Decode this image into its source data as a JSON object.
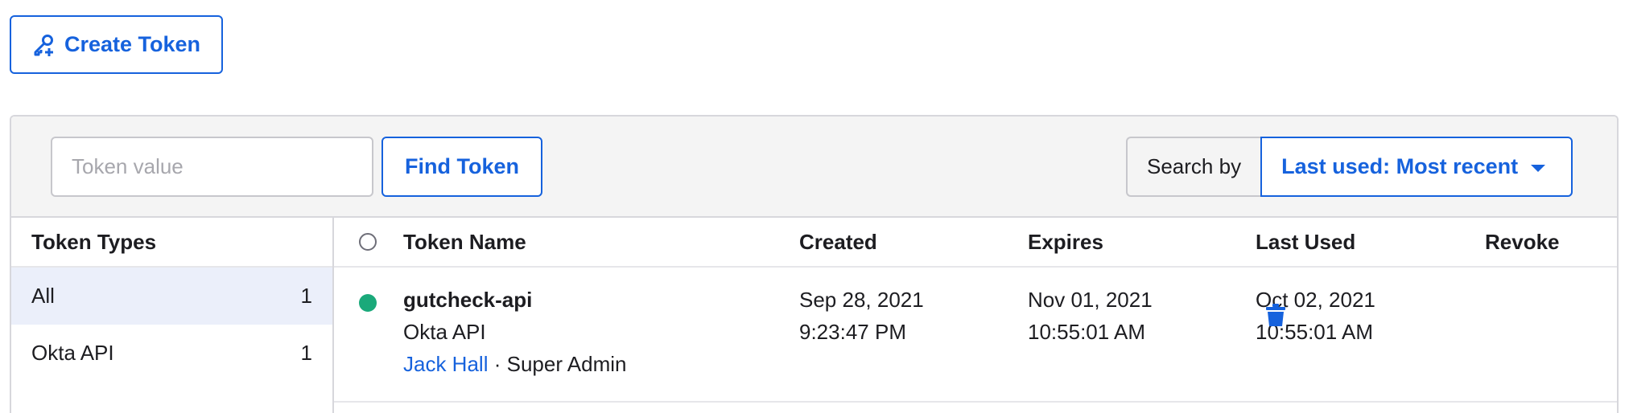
{
  "toolbar": {
    "create_token_label": "Create Token",
    "token_input_placeholder": "Token value",
    "find_token_label": "Find Token",
    "search_by_label": "Search by",
    "search_by_value": "Last used: Most recent"
  },
  "sidebar": {
    "heading": "Token Types",
    "items": [
      {
        "label": "All",
        "count": "1"
      },
      {
        "label": "Okta API",
        "count": "1"
      }
    ]
  },
  "table": {
    "columns": {
      "name": "Token Name",
      "created": "Created",
      "expires": "Expires",
      "last_used": "Last Used",
      "revoke": "Revoke"
    },
    "rows": [
      {
        "status_color": "#1aa97a",
        "name": "gutcheck-api",
        "type": "Okta API",
        "owner": "Jack Hall",
        "role": "· Super Admin",
        "created_date": "Sep 28, 2021",
        "created_time": "9:23:47 PM",
        "expires_date": "Nov 01, 2021",
        "expires_time": "10:55:01 AM",
        "last_used_date": "Oct 02, 2021",
        "last_used_time": "10:55:01 AM"
      }
    ]
  },
  "icons": {
    "create_token": "key-plus-icon",
    "revoke": "trash-icon",
    "search_by_dropdown": "caret-down-icon"
  },
  "colors": {
    "accent": "#1662dd",
    "active_bg": "#ebeffa",
    "status_active": "#1aa97a"
  }
}
